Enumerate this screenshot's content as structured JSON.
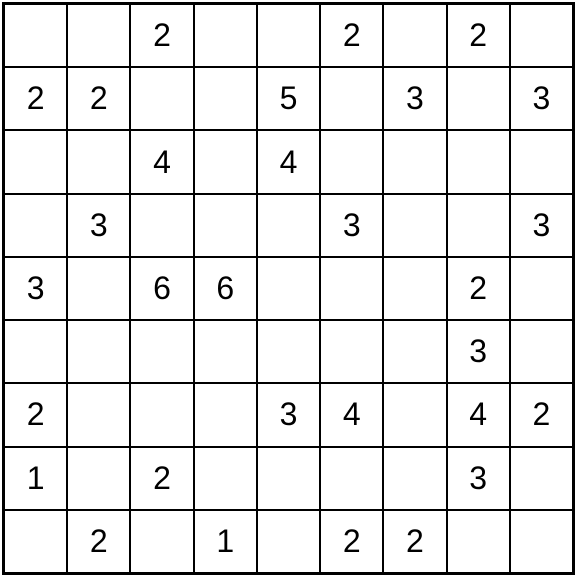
{
  "grid": {
    "rows": 9,
    "cols": 9,
    "cells": [
      [
        "",
        "",
        "2",
        "",
        "",
        "2",
        "",
        "2",
        ""
      ],
      [
        "2",
        "2",
        "",
        "",
        "5",
        "",
        "3",
        "",
        "3"
      ],
      [
        "",
        "",
        "4",
        "",
        "4",
        "",
        "",
        "",
        ""
      ],
      [
        "",
        "3",
        "",
        "",
        "",
        "3",
        "",
        "",
        "3"
      ],
      [
        "3",
        "",
        "6",
        "6",
        "",
        "",
        "",
        "2",
        ""
      ],
      [
        "",
        "",
        "",
        "",
        "",
        "",
        "",
        "3",
        ""
      ],
      [
        "2",
        "",
        "",
        "",
        "3",
        "4",
        "",
        "4",
        "2"
      ],
      [
        "1",
        "",
        "2",
        "",
        "",
        "",
        "",
        "3",
        ""
      ],
      [
        "",
        "2",
        "",
        "1",
        "",
        "2",
        "2",
        "",
        ""
      ]
    ]
  }
}
